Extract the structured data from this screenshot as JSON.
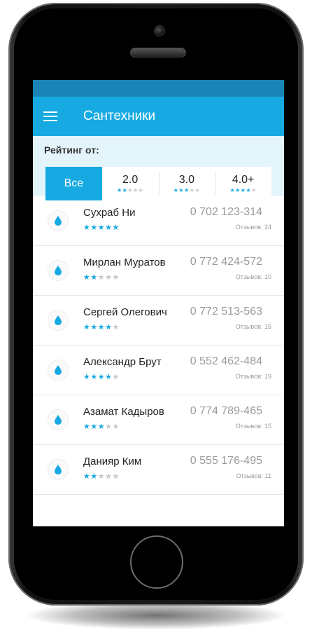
{
  "app": {
    "title": "Сантехники"
  },
  "filter": {
    "label": "Рейтинг от:",
    "options": [
      {
        "label": "Все",
        "stars": 0,
        "active": true
      },
      {
        "label": "2.0",
        "stars": 2,
        "active": false
      },
      {
        "label": "3.0",
        "stars": 3,
        "active": false
      },
      {
        "label": "4.0+",
        "stars": 4,
        "active": false
      }
    ]
  },
  "plumbers": [
    {
      "name": "Сухраб Ни",
      "phone": "0 702 123-314",
      "reviews": "Отзывов: 24",
      "rating": 5
    },
    {
      "name": "Мирлан Муратов",
      "phone": "0 772 424-572",
      "reviews": "Отзывов: 10",
      "rating": 2
    },
    {
      "name": "Сергей Олегович",
      "phone": "0 772 513-563",
      "reviews": "Отзывов: 15",
      "rating": 4
    },
    {
      "name": "Александр Брут",
      "phone": "0 552 462-484",
      "reviews": "Отзывов: 19",
      "rating": 4
    },
    {
      "name": "Азамат Кадыров",
      "phone": "0 774 789-465",
      "reviews": "Отзывов: 15",
      "rating": 3
    },
    {
      "name": "Данияр Ким",
      "phone": "0 555 176-495",
      "reviews": "Отзывов: 11",
      "rating": 2
    }
  ],
  "colors": {
    "accent": "#17a9e1",
    "status_bar": "#1a84b6",
    "filter_bg": "#e3f4fb",
    "star_off": "#c8c8c8"
  },
  "icons": {
    "menu": "hamburger-menu-icon",
    "item": "water-drop-icon",
    "star": "star-icon"
  }
}
